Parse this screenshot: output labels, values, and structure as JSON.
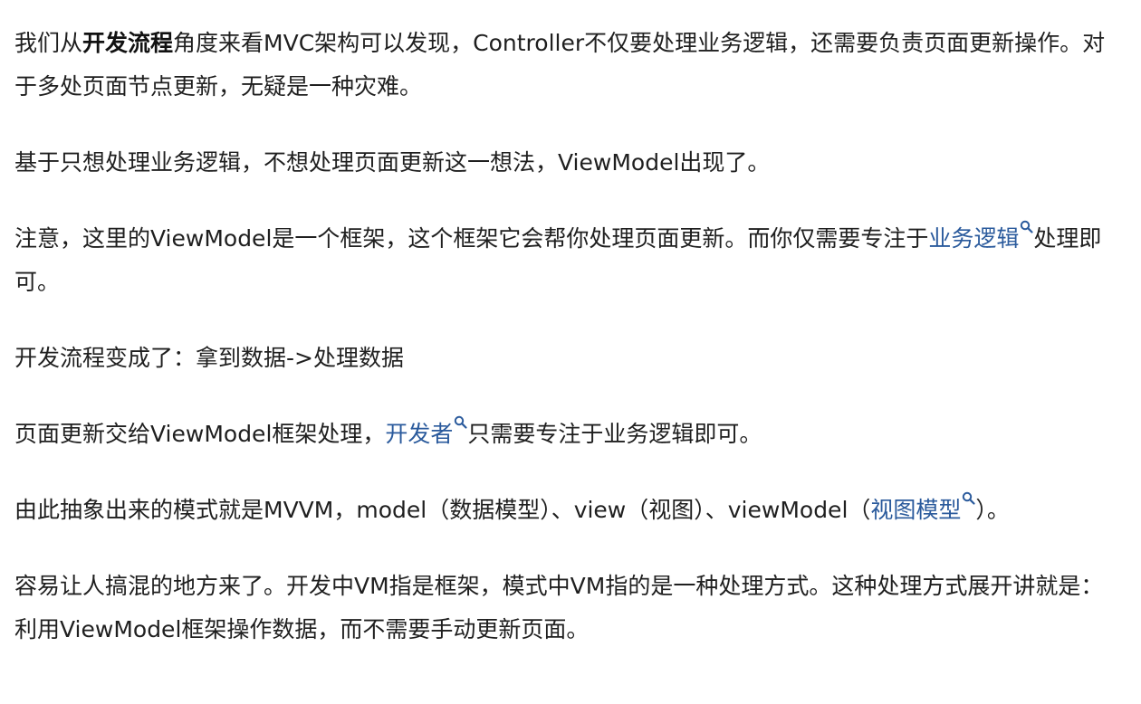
{
  "paragraphs": {
    "p1": {
      "before": "我们从",
      "bold": "开发流程",
      "after": "角度来看MVC架构可以发现，Controller不仅要处理业务逻辑，还需要负责页面更新操作。对于多处页面节点更新，无疑是一种灾难。"
    },
    "p2": {
      "text": "基于只想处理业务逻辑，不想处理页面更新这一想法，ViewModel出现了。"
    },
    "p3": {
      "before": "注意，这里的ViewModel是一个框架，这个框架它会帮你处理页面更新。而你仅需要专注于",
      "link": "业务逻辑",
      "after": "处理即可。"
    },
    "p4": {
      "text": "开发流程变成了：拿到数据->处理数据"
    },
    "p5": {
      "before": "页面更新交给ViewModel框架处理，",
      "link": "开发者",
      "after": "只需要专注于业务逻辑即可。"
    },
    "p6": {
      "before": "由此抽象出来的模式就是MVVM，model（数据模型）、view（视图）、viewModel（",
      "link": "视图模型",
      "after": "）。"
    },
    "p7": {
      "text": "容易让人搞混的地方来了。开发中VM指是框架，模式中VM指的是一种处理方式。这种处理方式展开讲就是：利用ViewModel框架操作数据，而不需要手动更新页面。"
    }
  },
  "colors": {
    "text": "#1f1f1f",
    "link": "#2a5a9c",
    "background": "#ffffff"
  },
  "icons": {
    "link_marker": "search-icon"
  }
}
